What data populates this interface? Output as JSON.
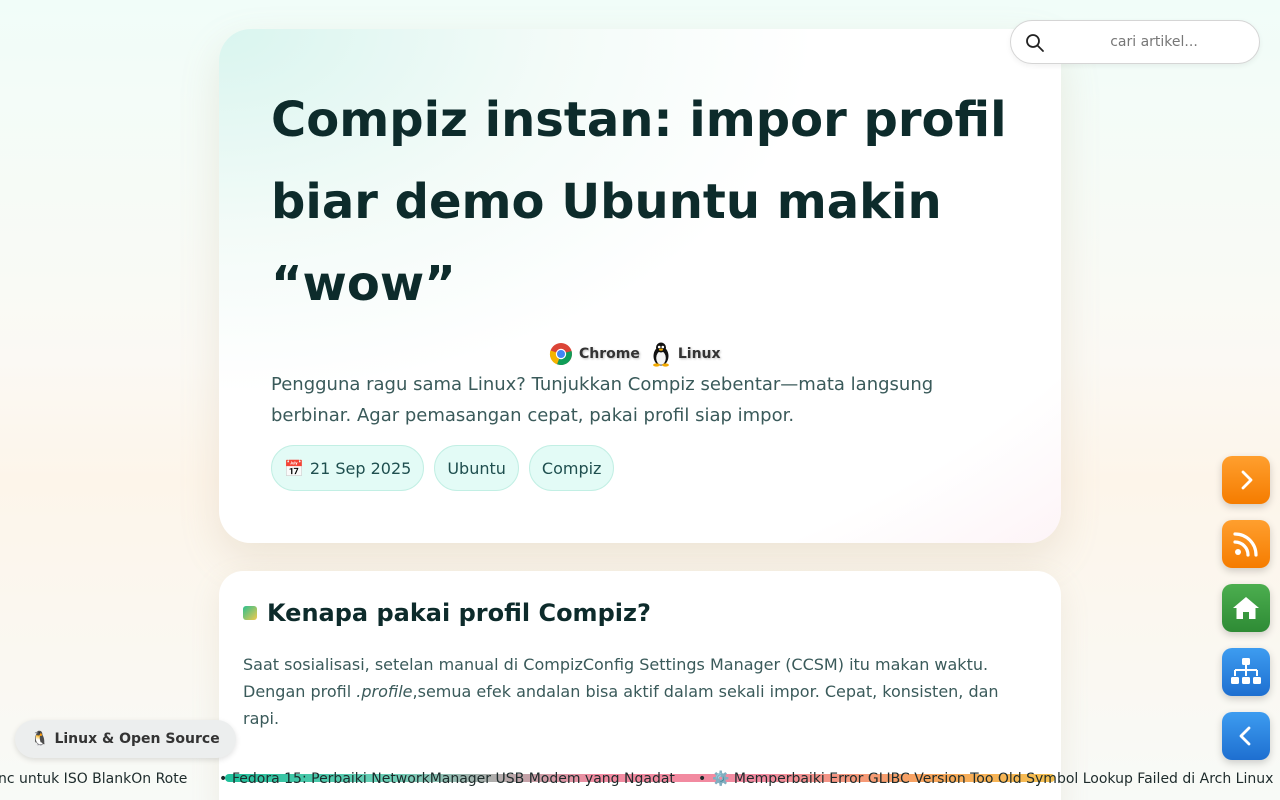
{
  "search": {
    "placeholder": "cari artikel..."
  },
  "hero": {
    "title": "Compiz instan: impor profil biar demo Ubuntu makin “wow”",
    "platforms": [
      {
        "label": "Chrome",
        "icon": "chrome-icon"
      },
      {
        "label": "Linux",
        "icon": "tux-icon"
      }
    ],
    "description": "Pengguna ragu sama Linux? Tunjukkan Compiz sebentar—mata langsung berbinar. Agar pemasangan cepat, pakai profil siap impor.",
    "date": "21 Sep 2025",
    "date_icon": "📅",
    "tags": [
      "Ubuntu",
      "Compiz"
    ]
  },
  "section": {
    "title": "Kenapa pakai profil Compiz?",
    "text_before": "Saat sosialisasi, setelan manual di CompizConfig Settings Manager (CCSM) itu makan waktu. Dengan profil ",
    "text_em": ".profile",
    "text_after": ",semua efek andalan bisa aktif dalam sekali impor. Cepat, konsisten, dan rapi."
  },
  "badge": {
    "icon": "🐧",
    "label": "Linux & Open Source"
  },
  "ticker": [
    {
      "text": "nc untuk ISO BlankOn Rote"
    },
    {
      "text": "Fedora 15: Perbaiki NetworkManager USB Modem yang Ngadat"
    },
    {
      "text": "⚙️ Memperbaiki Error GLIBC Version Too Old Symbol Lookup Failed di Arch Linux"
    }
  ],
  "colors": {
    "accent_teal": "#1fbf9a",
    "fab_orange": "#f57c00",
    "fab_green": "#2e8b35",
    "fab_blue": "#1e6fd0"
  }
}
